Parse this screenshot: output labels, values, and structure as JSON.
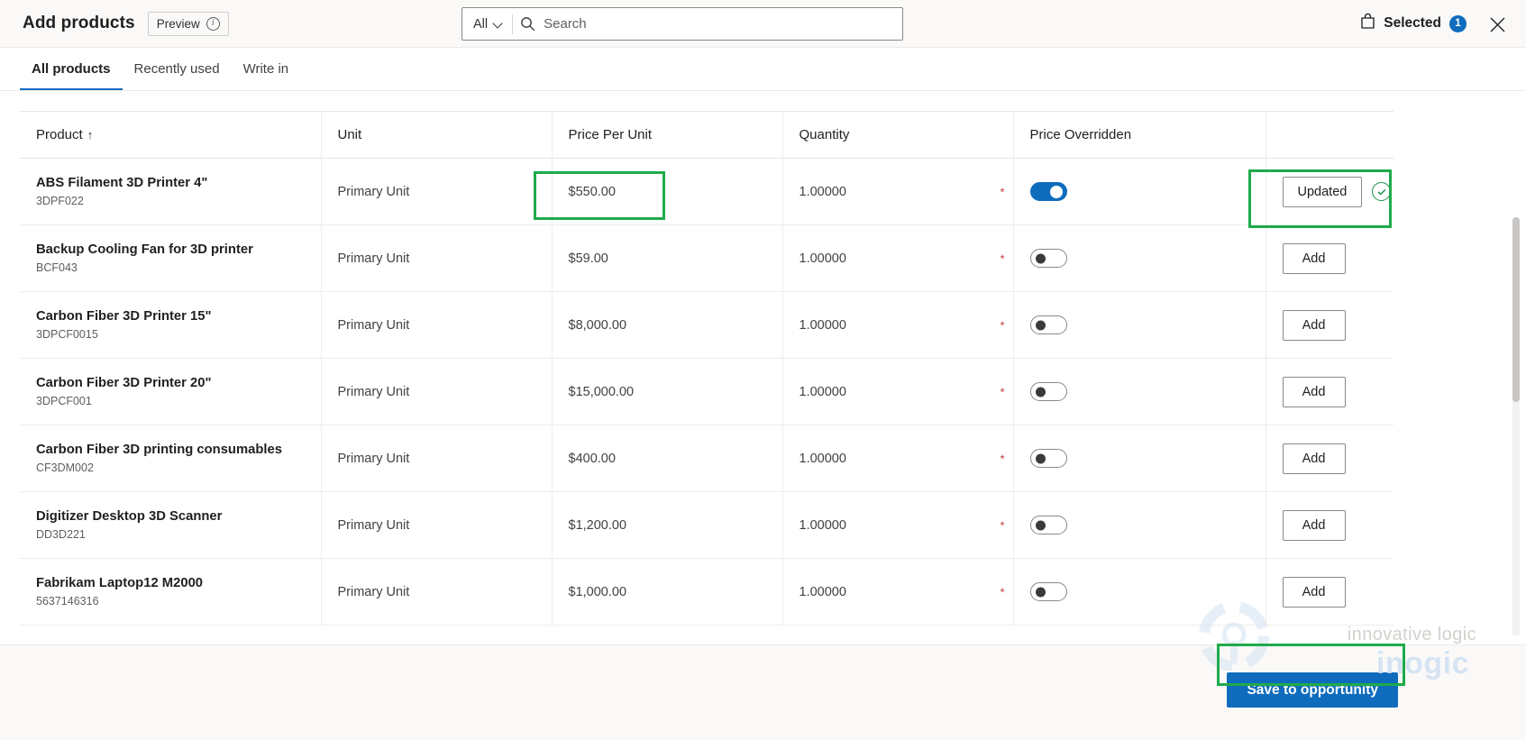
{
  "header": {
    "title": "Add products",
    "preview_label": "Preview",
    "info_icon": "info-circle-icon",
    "selected_label": "Selected",
    "selected_count": "1",
    "bag_icon": "shopping-bag-icon",
    "close_icon": "close-icon"
  },
  "search": {
    "scope_label": "All",
    "chevron_icon": "chevron-down-icon",
    "search_icon": "search-icon",
    "placeholder": "Search",
    "value": ""
  },
  "tabs": [
    {
      "label": "All products",
      "active": true
    },
    {
      "label": "Recently used",
      "active": false
    },
    {
      "label": "Write in",
      "active": false
    }
  ],
  "table": {
    "columns": [
      "Product",
      "Unit",
      "Price Per Unit",
      "Quantity",
      "Price Overridden",
      ""
    ],
    "sort_column": "Product",
    "sort_icon": "sort-ascending-arrow-icon",
    "rows": [
      {
        "product": "ABS Filament 3D Printer 4\"",
        "code": "3DPF022",
        "unit": "Primary Unit",
        "price": "$550.00",
        "quantity": "1.00000",
        "required_marker": "*",
        "price_overridden": true,
        "action_label": "Updated",
        "action_state": "updated",
        "check_icon": "check-circle-icon"
      },
      {
        "product": "Backup Cooling Fan for 3D printer",
        "code": "BCF043",
        "unit": "Primary Unit",
        "price": "$59.00",
        "quantity": "1.00000",
        "required_marker": "*",
        "price_overridden": false,
        "action_label": "Add",
        "action_state": "add",
        "check_icon": ""
      },
      {
        "product": "Carbon Fiber 3D Printer 15\"",
        "code": "3DPCF0015",
        "unit": "Primary Unit",
        "price": "$8,000.00",
        "quantity": "1.00000",
        "required_marker": "*",
        "price_overridden": false,
        "action_label": "Add",
        "action_state": "add",
        "check_icon": ""
      },
      {
        "product": "Carbon Fiber 3D Printer 20\"",
        "code": "3DPCF001",
        "unit": "Primary Unit",
        "price": "$15,000.00",
        "quantity": "1.00000",
        "required_marker": "*",
        "price_overridden": false,
        "action_label": "Add",
        "action_state": "add",
        "check_icon": ""
      },
      {
        "product": "Carbon Fiber 3D printing consumables",
        "code": "CF3DM002",
        "unit": "Primary Unit",
        "price": "$400.00",
        "quantity": "1.00000",
        "required_marker": "*",
        "price_overridden": false,
        "action_label": "Add",
        "action_state": "add",
        "check_icon": ""
      },
      {
        "product": "Digitizer Desktop 3D Scanner",
        "code": "DD3D221",
        "unit": "Primary Unit",
        "price": "$1,200.00",
        "quantity": "1.00000",
        "required_marker": "*",
        "price_overridden": false,
        "action_label": "Add",
        "action_state": "add",
        "check_icon": ""
      },
      {
        "product": "Fabrikam Laptop12 M2000",
        "code": "5637146316",
        "unit": "Primary Unit",
        "price": "$1,000.00",
        "quantity": "1.00000",
        "required_marker": "*",
        "price_overridden": false,
        "action_label": "Add",
        "action_state": "add",
        "check_icon": ""
      }
    ]
  },
  "footer": {
    "save_label": "Save to opportunity"
  },
  "watermark": {
    "line1": "innovative logic",
    "line2": "inogic"
  },
  "colors": {
    "accent": "#0f6cbd",
    "highlight": "#1faa4b",
    "required": "#c23b3b",
    "check": "#16914a"
  }
}
